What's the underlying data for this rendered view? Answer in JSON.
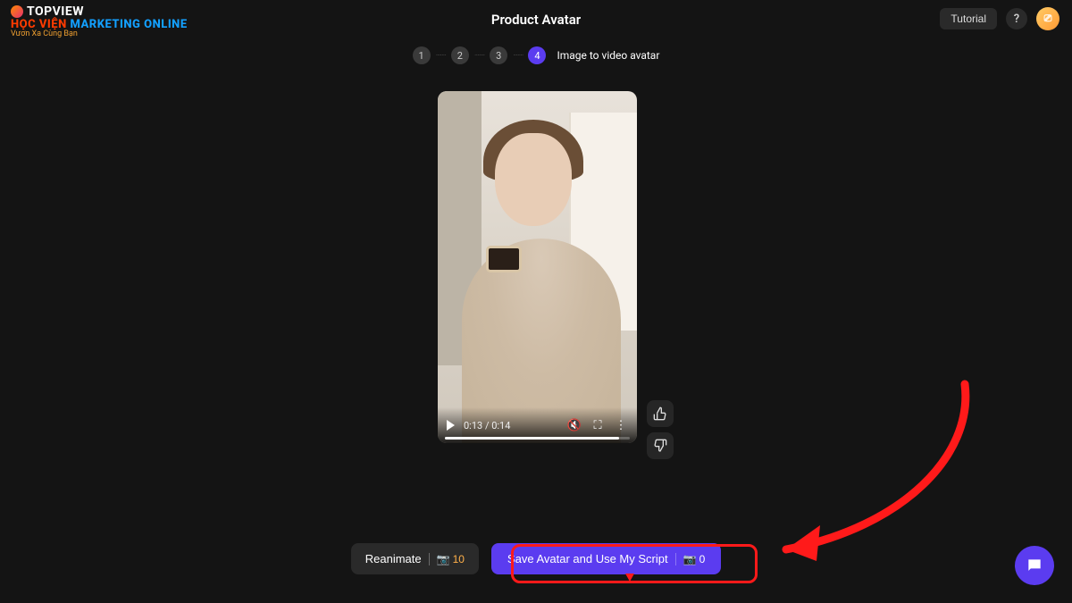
{
  "header": {
    "title": "Product Avatar",
    "tutorial_label": "Tutorial",
    "help_label": "?",
    "logo": {
      "brand": "TOPVIEW",
      "line2a": "HỌC VIỆN",
      "line2b": "MARKETING ONLINE",
      "line3": "Vươn Xa Cùng Bạn"
    }
  },
  "stepper": {
    "s1": "1",
    "s2": "2",
    "s3": "3",
    "s4": "4",
    "label": "Image to video avatar"
  },
  "video": {
    "time_current": "0:13",
    "time_total": "0:14",
    "time_display": "0:13 / 0:14"
  },
  "actions": {
    "reanimate_label": "Reanimate",
    "reanimate_cost": "10",
    "save_label": "Save Avatar and Use My Script",
    "save_cost": "0"
  },
  "icons": {
    "credit_glyph": "📷",
    "thumb_up": "👍",
    "thumb_down": "👎",
    "mute": "🔇",
    "fullscreen": "⛶",
    "more": "⋮"
  }
}
